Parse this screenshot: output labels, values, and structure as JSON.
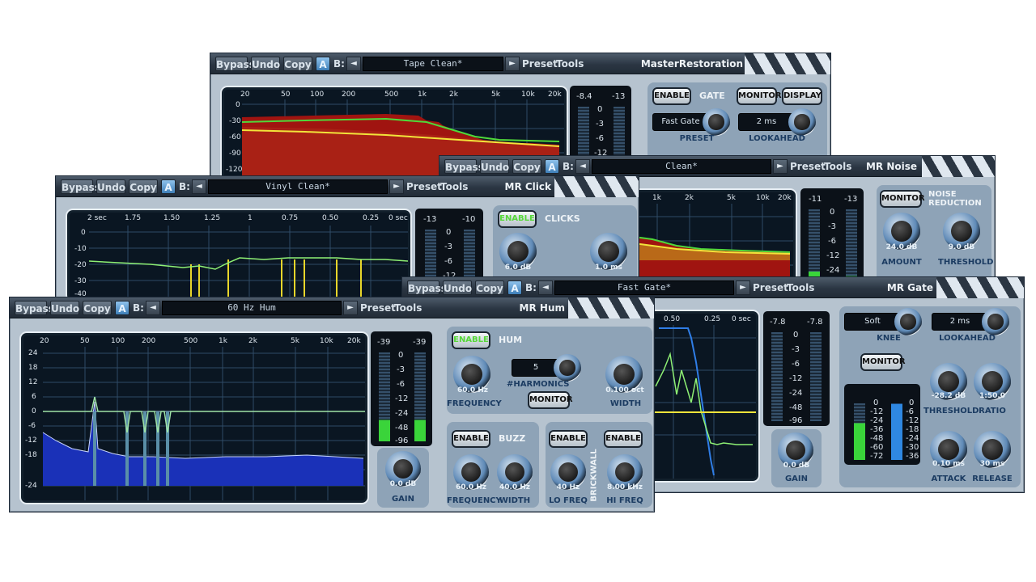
{
  "toolbar": {
    "bypass": "Bypass",
    "undo": "Undo",
    "copy": "Copy",
    "ab": "A",
    "b": "B:",
    "prev": "◄",
    "next": "►",
    "preset": "Preset",
    "tools": "Tools"
  },
  "colors": {
    "accent": "#4a8fd0",
    "enable_on": "#57d83a",
    "title_bar": "#2b3643"
  },
  "icons": [
    "knob-icon",
    "arrow-left-icon",
    "arrow-right-icon"
  ],
  "master": {
    "title": "MasterRestoration",
    "preset": "Tape Clean*",
    "freq_ticks": [
      "20",
      "50",
      "100",
      "200",
      "500",
      "1k",
      "2k",
      "5k",
      "10k",
      "20k"
    ],
    "db_ticks": [
      "0",
      "-30",
      "-60",
      "-90",
      "-120"
    ],
    "meter": {
      "left": "-8.4",
      "right": "-13",
      "scale": [
        "0",
        "-3",
        "-6",
        "-12"
      ]
    },
    "gate": {
      "enable": "ENABLE",
      "header": "GATE",
      "monitor": "MONITOR",
      "display": "DISPLAY",
      "preset_value": "Fast Gate",
      "preset_label": "PRESET",
      "lookahead_value": "2 ms",
      "lookahead_label": "LOOKAHEAD"
    }
  },
  "noise": {
    "title": "MR Noise",
    "preset": "Clean*",
    "freq_ticks": [
      "1k",
      "2k",
      "5k",
      "10k",
      "20k"
    ],
    "meter": {
      "left": "-11",
      "right": "-13",
      "scale": [
        "0",
        "-3",
        "-6",
        "-12",
        "-24"
      ]
    },
    "monitor": "MONITOR",
    "header": "NOISE REDUCTION",
    "amount": {
      "value": "24.0 dB",
      "label": "AMOUNT"
    },
    "threshold": {
      "value": "9.0 dB",
      "label": "THRESHOLD"
    }
  },
  "click": {
    "title": "MR Click",
    "preset": "Vinyl Clean*",
    "time_ticks": [
      "2 sec",
      "1.75",
      "1.50",
      "1.25",
      "1",
      "0.75",
      "0.50",
      "0.25",
      "0 sec"
    ],
    "db_ticks": [
      "0",
      "-10",
      "-20",
      "-30",
      "-40"
    ],
    "meter": {
      "left": "-13",
      "right": "-10",
      "scale": [
        "0",
        "-3",
        "-6",
        "-12"
      ]
    },
    "enable": "ENABLE",
    "header": "CLICKS",
    "knob1": "6.0 dB",
    "knob2": "1.0 ms"
  },
  "gate": {
    "title": "MR Gate",
    "preset": "Fast Gate*",
    "time_ticks": [
      "0.50",
      "0.25",
      "0 sec"
    ],
    "meter": {
      "left": "-7.8",
      "right": "-7.8",
      "scale": [
        "0",
        "-3",
        "-6",
        "-12",
        "-24",
        "-48",
        "-96"
      ]
    },
    "gain": {
      "value": "0.0 dB",
      "label": "GAIN"
    },
    "knee": {
      "value": "Soft",
      "label": "KNEE"
    },
    "lookahead": {
      "value": "2 ms",
      "label": "LOOKAHEAD"
    },
    "monitor": "MONITOR",
    "threshold": {
      "value": "-28.2 dB",
      "label": "THRESHOLD"
    },
    "ratio": {
      "value": "1:50.0",
      "label": "RATIO"
    },
    "attack": {
      "value": "0.10 ms",
      "label": "ATTACK"
    },
    "release": {
      "value": "30 ms",
      "label": "RELEASE"
    },
    "gr_scale_left": [
      "0",
      "-12",
      "-24",
      "-36",
      "-48",
      "-60",
      "-72"
    ],
    "gr_scale_right": [
      "0",
      "-6",
      "-12",
      "-18",
      "-24",
      "-30",
      "-36"
    ]
  },
  "hum": {
    "title": "MR Hum",
    "preset": "60 Hz Hum",
    "freq_ticks": [
      "20",
      "50",
      "100",
      "200",
      "500",
      "1k",
      "2k",
      "5k",
      "10k",
      "20k"
    ],
    "db_ticks": [
      "24",
      "18",
      "12",
      "6",
      "0",
      "-6",
      "-12",
      "-18",
      "-24"
    ],
    "meter": {
      "left": "-39",
      "right": "-39",
      "scale": [
        "0",
        "-3",
        "-6",
        "-12",
        "-24",
        "-48",
        "-96"
      ]
    },
    "gain": {
      "value": "0.0 dB",
      "label": "GAIN"
    },
    "hum": {
      "enable": "ENABLE",
      "header": "HUM",
      "harmonics_value": "5",
      "harmonics_label": "#HARMONICS",
      "frequency": {
        "value": "60.0 Hz",
        "label": "FREQUENCY"
      },
      "width": {
        "value": "0.100 oct",
        "label": "WIDTH"
      },
      "monitor": "MONITOR"
    },
    "buzz": {
      "enable": "ENABLE",
      "header": "BUZZ",
      "frequency": {
        "value": "60.0 Hz",
        "label": "FREQUENCY"
      },
      "width": {
        "value": "40.0 Hz",
        "label": "WIDTH"
      }
    },
    "brickwall": {
      "header": "BRICKWALL",
      "enable_lo": "ENABLE",
      "enable_hi": "ENABLE",
      "lo": {
        "value": "40 Hz",
        "label": "LO FREQ"
      },
      "hi": {
        "value": "8.00 kHz",
        "label": "HI FREQ"
      }
    }
  }
}
